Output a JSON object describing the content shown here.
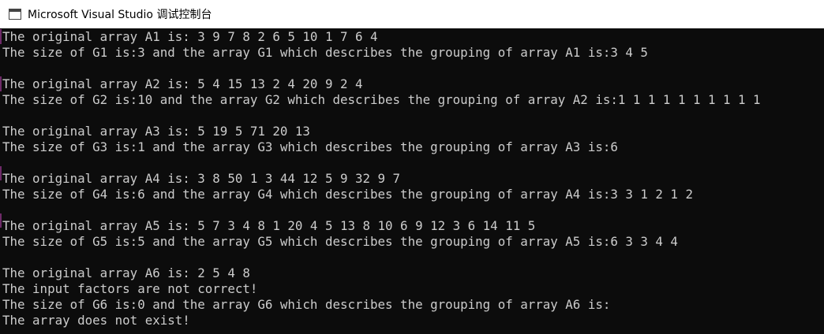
{
  "window": {
    "title": "Microsoft Visual Studio 调试控制台",
    "icon": "console-app-icon"
  },
  "console": {
    "lines": [
      "The original array A1 is: 3 9 7 8 2 6 5 10 1 7 6 4",
      "The size of G1 is:3 and the array G1 which describes the grouping of array A1 is:3 4 5",
      "",
      "The original array A2 is: 5 4 15 13 2 4 20 9 2 4",
      "The size of G2 is:10 and the array G2 which describes the grouping of array A2 is:1 1 1 1 1 1 1 1 1 1",
      "",
      "The original array A3 is: 5 19 5 71 20 13",
      "The size of G3 is:1 and the array G3 which describes the grouping of array A3 is:6",
      "",
      "The original array A4 is: 3 8 50 1 3 44 12 5 9 32 9 7",
      "The size of G4 is:6 and the array G4 which describes the grouping of array A4 is:3 3 1 2 1 2",
      "",
      "The original array A5 is: 5 7 3 4 8 1 20 4 5 13 8 10 6 9 12 3 6 14 11 5",
      "The size of G5 is:5 and the array G5 which describes the grouping of array A5 is:6 3 3 4 4",
      "",
      "The original array A6 is: 2 5 4 8",
      "The input factors are not correct!",
      "The size of G6 is:0 and the array G6 which describes the grouping of array A6 is:",
      "The array does not exist!"
    ]
  }
}
